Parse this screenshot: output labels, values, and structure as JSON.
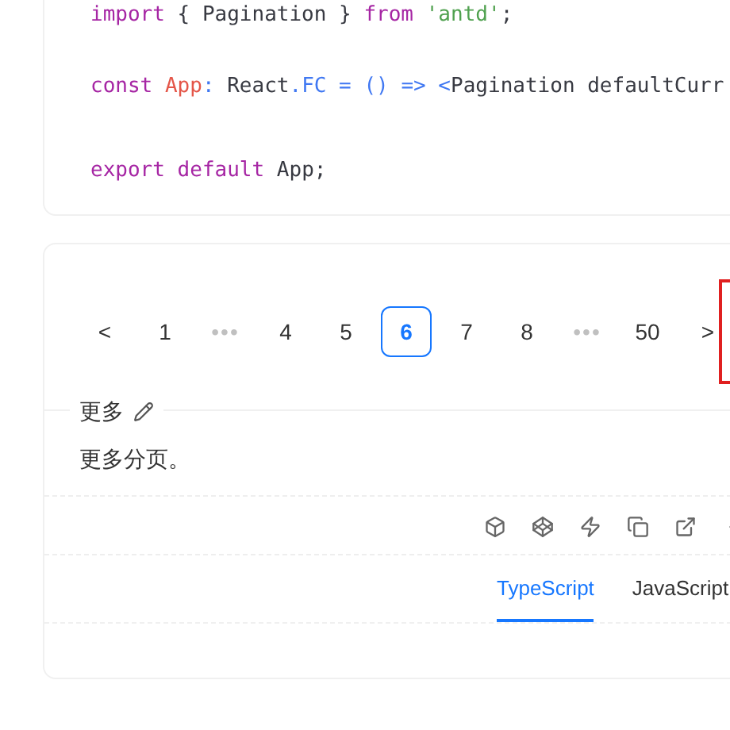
{
  "code_lines": [
    {
      "tokens": [
        {
          "text": "import",
          "kind": "keyword"
        },
        {
          "text": " { Pagination } ",
          "kind": "plain"
        },
        {
          "text": "from",
          "kind": "keyword"
        },
        {
          "text": " 'antd'",
          "kind": "string"
        },
        {
          "text": ";",
          "kind": "plain"
        }
      ]
    },
    {
      "tokens": [
        {
          "text": "const",
          "kind": "keyword"
        },
        {
          "text": " App",
          "kind": "variable"
        },
        {
          "text": ":",
          "kind": "punct"
        },
        {
          "text": " React",
          "kind": "plain"
        },
        {
          "text": ".FC",
          "kind": "punct"
        },
        {
          "text": " = () ",
          "kind": "punct"
        },
        {
          "text": "=>",
          "kind": "punct"
        },
        {
          "text": " <",
          "kind": "punct"
        },
        {
          "text": "Pagination defaultCurr",
          "kind": "plain"
        }
      ]
    },
    {
      "tokens": [
        {
          "text": "export",
          "kind": "keyword"
        },
        {
          "text": " default",
          "kind": "keyword"
        },
        {
          "text": " App;",
          "kind": "plain"
        }
      ]
    }
  ],
  "pagination": [
    {
      "kind": "prev",
      "label": "<"
    },
    {
      "kind": "page",
      "label": "1",
      "selected": false
    },
    {
      "kind": "ellipsis",
      "label": "•••"
    },
    {
      "kind": "page",
      "label": "4",
      "selected": false
    },
    {
      "kind": "page",
      "label": "5",
      "selected": false
    },
    {
      "kind": "page",
      "label": "6",
      "selected": true
    },
    {
      "kind": "page",
      "label": "7",
      "selected": false
    },
    {
      "kind": "page",
      "label": "8",
      "selected": false
    },
    {
      "kind": "ellipsis",
      "label": "•••"
    },
    {
      "kind": "page",
      "label": "50",
      "selected": false
    },
    {
      "kind": "next",
      "label": ">"
    }
  ],
  "section": {
    "title": "更多",
    "description": "更多分页。"
  },
  "tabs": [
    {
      "label": "TypeScript",
      "selected": true
    },
    {
      "label": "JavaScript",
      "selected": false
    }
  ]
}
